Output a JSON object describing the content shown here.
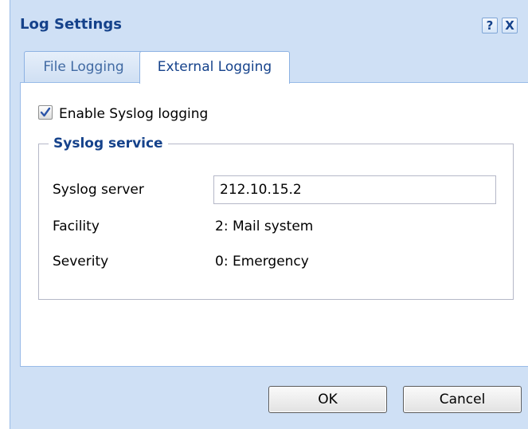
{
  "dialog": {
    "title": "Log Settings",
    "help_symbol": "?",
    "close_symbol": "X"
  },
  "tabs": [
    {
      "label": "File Logging",
      "active": false
    },
    {
      "label": "External Logging",
      "active": true
    }
  ],
  "syslog": {
    "enable_label": "Enable Syslog logging",
    "enabled": true,
    "legend": "Syslog service",
    "server_label": "Syslog server",
    "server_value": "212.10.15.2",
    "facility_label": "Facility",
    "facility_value": "2: Mail system",
    "severity_label": "Severity",
    "severity_value": "0: Emergency"
  },
  "buttons": {
    "ok": "OK",
    "cancel": "Cancel"
  },
  "colors": {
    "frame": "#cfe0f5",
    "title_text": "#15428b",
    "border": "#99bbe8"
  }
}
